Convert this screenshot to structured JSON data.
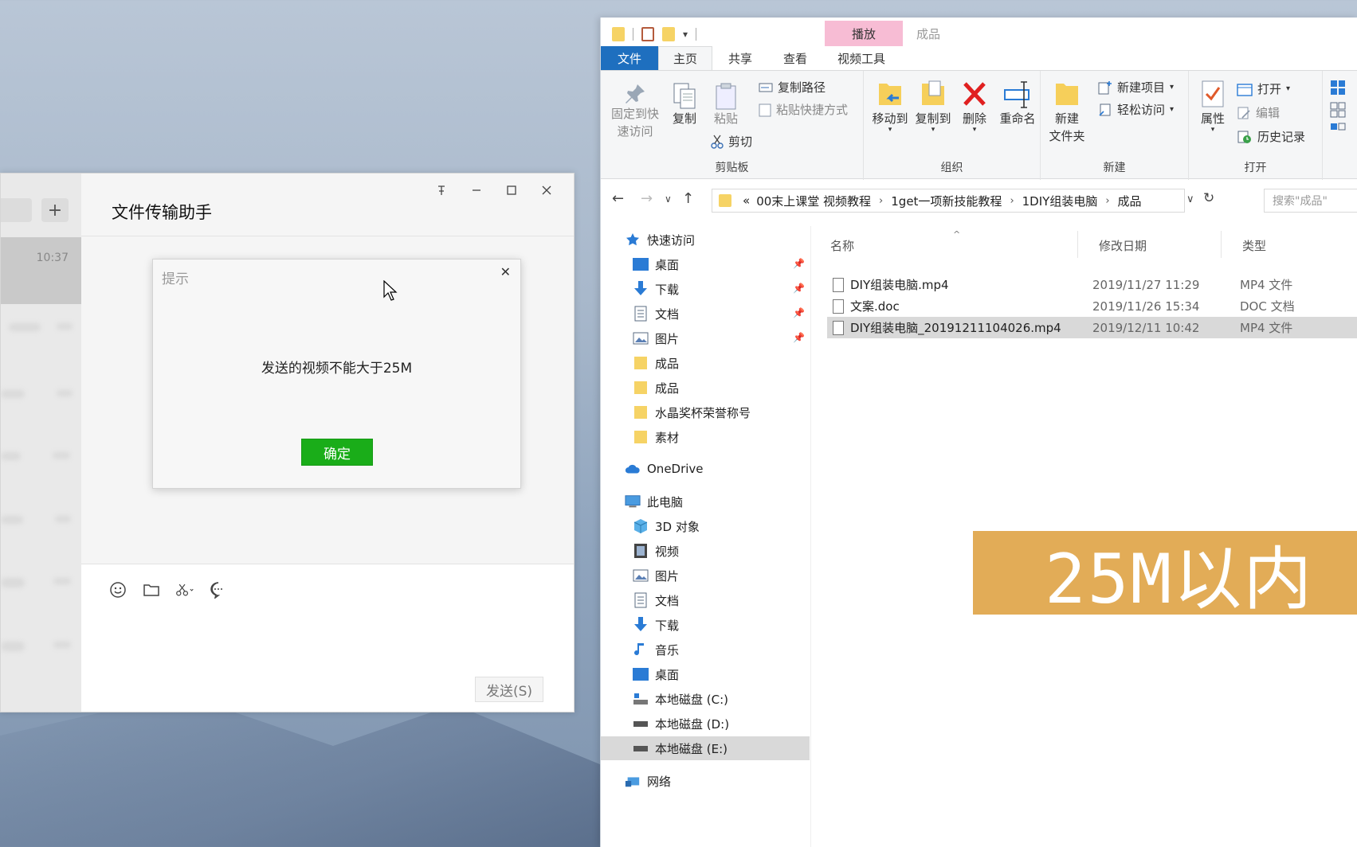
{
  "wechat": {
    "chat_time": "10:37",
    "title": "文件传输助手",
    "send_label": "发送(S)",
    "dialog": {
      "title": "提示",
      "message": "发送的视频不能大于25M",
      "ok_label": "确定"
    }
  },
  "explorer": {
    "context_tab": "播放",
    "context_title": "成品",
    "tabs": [
      "文件",
      "主页",
      "共享",
      "查看",
      "视频工具"
    ],
    "ribbon": {
      "pin_label_1": "固定到快",
      "pin_label_2": "速访问",
      "copy_label": "复制",
      "paste_label": "粘贴",
      "copy_path_label": "复制路径",
      "paste_shortcut_label": "粘贴快捷方式",
      "cut_label": "剪切",
      "clipboard_group": "剪贴板",
      "move_to_label": "移动到",
      "copy_to_label": "复制到",
      "delete_label": "删除",
      "rename_label": "重命名",
      "organize_group": "组织",
      "new_folder_label_1": "新建",
      "new_folder_label_2": "文件夹",
      "new_item_label": "新建项目",
      "easy_access_label": "轻松访问",
      "new_group": "新建",
      "properties_label": "属性",
      "open_label": "打开",
      "edit_label": "编辑",
      "history_label": "历史记录",
      "open_group": "打开"
    },
    "address": {
      "prefix": "«",
      "segments": [
        "00末上课堂 视频教程",
        "1get一项新技能教程",
        "1DIY组装电脑",
        "成品"
      ],
      "search_placeholder": "搜索\"成品\""
    },
    "nav": {
      "quick_access": "快速访问",
      "quick_items": [
        "桌面",
        "下载",
        "文档",
        "图片",
        "成品",
        "成品",
        "水晶奖杯荣誉称号",
        "素材"
      ],
      "onedrive": "OneDrive",
      "this_pc": "此电脑",
      "pc_items": [
        "3D 对象",
        "视频",
        "图片",
        "文档",
        "下载",
        "音乐",
        "桌面",
        "本地磁盘 (C:)",
        "本地磁盘 (D:)",
        "本地磁盘 (E:)"
      ],
      "network": "网络"
    },
    "columns": {
      "name": "名称",
      "date": "修改日期",
      "type": "类型"
    },
    "files": [
      {
        "name": "DIY组装电脑.mp4",
        "date": "2019/11/27 11:29",
        "type": "MP4 文件"
      },
      {
        "name": "文案.doc",
        "date": "2019/11/26 15:34",
        "type": "DOC 文档"
      },
      {
        "name": "DIY组装电脑_20191211104026.mp4",
        "date": "2019/12/11 10:42",
        "type": "MP4 文件"
      }
    ]
  },
  "overlay": {
    "banner_text": "25M以内"
  },
  "colors": {
    "wechat_green": "#1aad19",
    "file_tab_blue": "#1e6fbf",
    "banner_orange": "#e2ac57",
    "context_pink": "#f7bcd4"
  }
}
